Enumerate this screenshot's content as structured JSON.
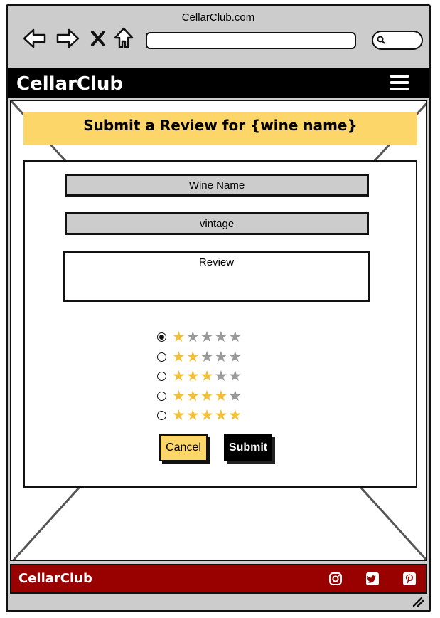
{
  "browser": {
    "title": "CellarClub.com",
    "address_value": ""
  },
  "navbar": {
    "brand": "CellarClub",
    "menu_icon": "hamburger-icon"
  },
  "page": {
    "heading": "Submit a Review for {wine name}"
  },
  "form": {
    "wine_name_placeholder": "Wine Name",
    "vintage_placeholder": "vintage",
    "review_placeholder": "Review",
    "ratings": [
      {
        "stars": 1,
        "selected": true
      },
      {
        "stars": 2,
        "selected": false
      },
      {
        "stars": 3,
        "selected": false
      },
      {
        "stars": 4,
        "selected": false
      },
      {
        "stars": 5,
        "selected": false
      }
    ],
    "cancel_label": "Cancel",
    "submit_label": "Submit"
  },
  "footer": {
    "brand": "CellarClub",
    "social": [
      "instagram-icon",
      "twitter-icon",
      "pinterest-icon"
    ]
  },
  "colors": {
    "accent_yellow": "#fdd669",
    "star_filled": "#f2c038",
    "star_empty": "#999999",
    "footer_red": "#990000",
    "navbar_black": "#000000"
  }
}
